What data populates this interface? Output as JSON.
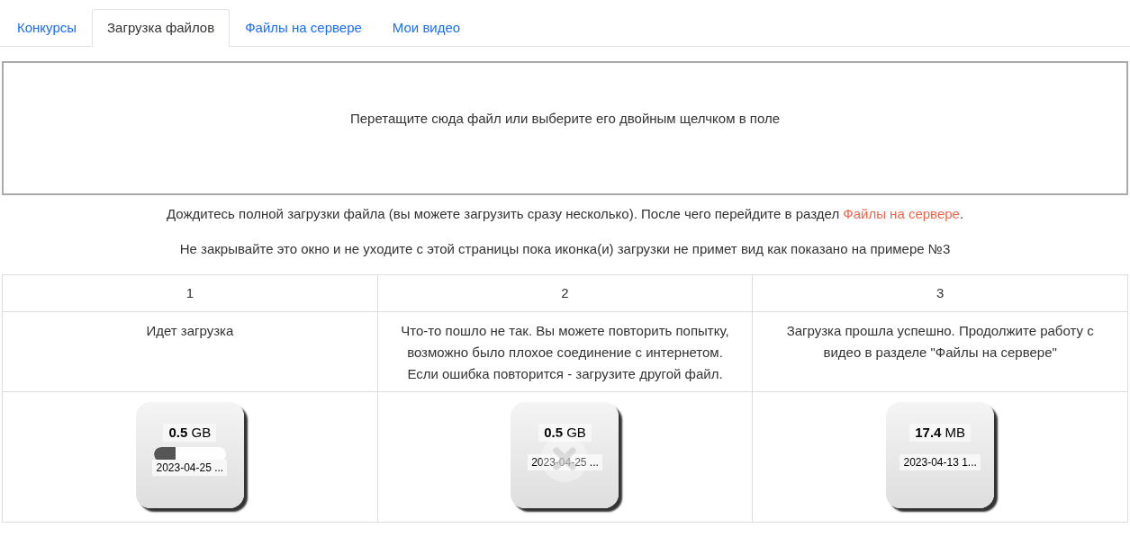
{
  "tabs": [
    {
      "label": "Конкурсы",
      "selected": false
    },
    {
      "label": "Загрузка файлов",
      "selected": true
    },
    {
      "label": "Файлы на сервере",
      "selected": false
    },
    {
      "label": "Мои видео",
      "selected": false
    }
  ],
  "dropzone": {
    "text": "Перетащите сюда файл или выберите его двойным щелчком в поле"
  },
  "notice": {
    "text": "Дождитесь полной загрузки файла (вы можете загрузить сразу несколько). После чего перейдите в раздел ",
    "link": "Файлы на сервере",
    "end": "."
  },
  "warning": "Не закрывайте это окно и не уходите с этой страницы пока иконка(и) загрузки не примет вид как показано на примере №3",
  "examples": [
    {
      "number": "1",
      "description": "Идет загрузка",
      "file": {
        "kind": "uploading",
        "size": "**0.5** GB",
        "date": "2023-04-25 ...",
        "level": 0.3
      }
    },
    {
      "number": "2",
      "description": "Что-то пошло не так. Вы можете повторить попытку, возможно было плохое соединение с интернетом. Если ошибка повторится - загрузите другой файл.",
      "file": {
        "kind": "error",
        "size": "**0.5** GB",
        "date": "2023-04-25 ..."
      }
    },
    {
      "number": "3",
      "description": "Загрузка прошла успешно. Продолжите работу с видео в разделе \"Файлы на сервере\"",
      "file": {
        "kind": "done",
        "size": "**17.4** MB",
        "date": "2023-04-13 1..."
      }
    }
  ]
}
